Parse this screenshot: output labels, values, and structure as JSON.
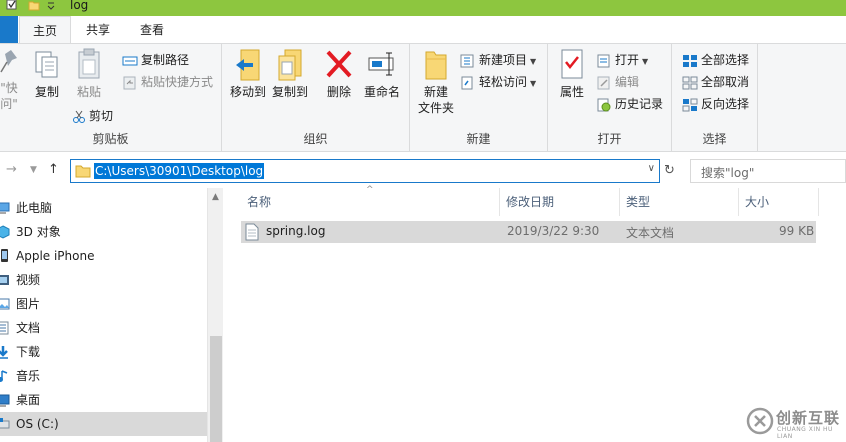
{
  "window": {
    "title": "log"
  },
  "tabs": {
    "file": "",
    "home": "主页",
    "share": "共享",
    "view": "查看"
  },
  "ribbon": {
    "clipboard": {
      "pin_label": "固定到\"快速访问\"",
      "pin_line1": "\"快",
      "pin_line2": "问\"",
      "copy": "复制",
      "paste": "粘贴",
      "copy_path": "复制路径",
      "paste_shortcut": "粘贴快捷方式",
      "cut": "剪切",
      "label": "剪贴板"
    },
    "organize": {
      "move_to": "移动到",
      "copy_to": "复制到",
      "delete": "删除",
      "rename": "重命名",
      "label": "组织"
    },
    "new": {
      "new_folder_line1": "新建",
      "new_folder_line2": "文件夹",
      "new_item": "新建项目",
      "easy_access": "轻松访问",
      "label": "新建"
    },
    "open": {
      "properties": "属性",
      "open": "打开",
      "edit": "编辑",
      "history": "历史记录",
      "label": "打开"
    },
    "select": {
      "select_all": "全部选择",
      "select_none": "全部取消",
      "invert": "反向选择",
      "label": "选择"
    }
  },
  "address_bar": {
    "path": "C:\\Users\\30901\\Desktop\\log",
    "search_placeholder": "搜索\"log\""
  },
  "nav_pane": {
    "items": [
      {
        "label": "此电脑",
        "icon": "pc-icon"
      },
      {
        "label": "3D 对象",
        "icon": "3d-objects-icon"
      },
      {
        "label": "Apple iPhone",
        "icon": "phone-icon"
      },
      {
        "label": "视频",
        "icon": "video-icon"
      },
      {
        "label": "图片",
        "icon": "pictures-icon"
      },
      {
        "label": "文档",
        "icon": "documents-icon"
      },
      {
        "label": "下载",
        "icon": "downloads-icon"
      },
      {
        "label": "音乐",
        "icon": "music-icon"
      },
      {
        "label": "桌面",
        "icon": "desktop-icon"
      },
      {
        "label": "OS (C:)",
        "icon": "drive-icon"
      }
    ]
  },
  "file_list": {
    "columns": [
      "名称",
      "修改日期",
      "类型",
      "大小"
    ],
    "rows": [
      {
        "name": "spring.log",
        "modified": "2019/3/22 9:30",
        "type": "文本文档",
        "size": "99 KB"
      }
    ]
  },
  "watermark": {
    "text": "创新互联",
    "sub": "CHUANG XIN HU LIAN"
  },
  "colors": {
    "titlebar": "#8dc63f",
    "file_tab": "#1979ca",
    "selection": "#0078d7",
    "ribbon_bg": "#f5f6f7"
  }
}
